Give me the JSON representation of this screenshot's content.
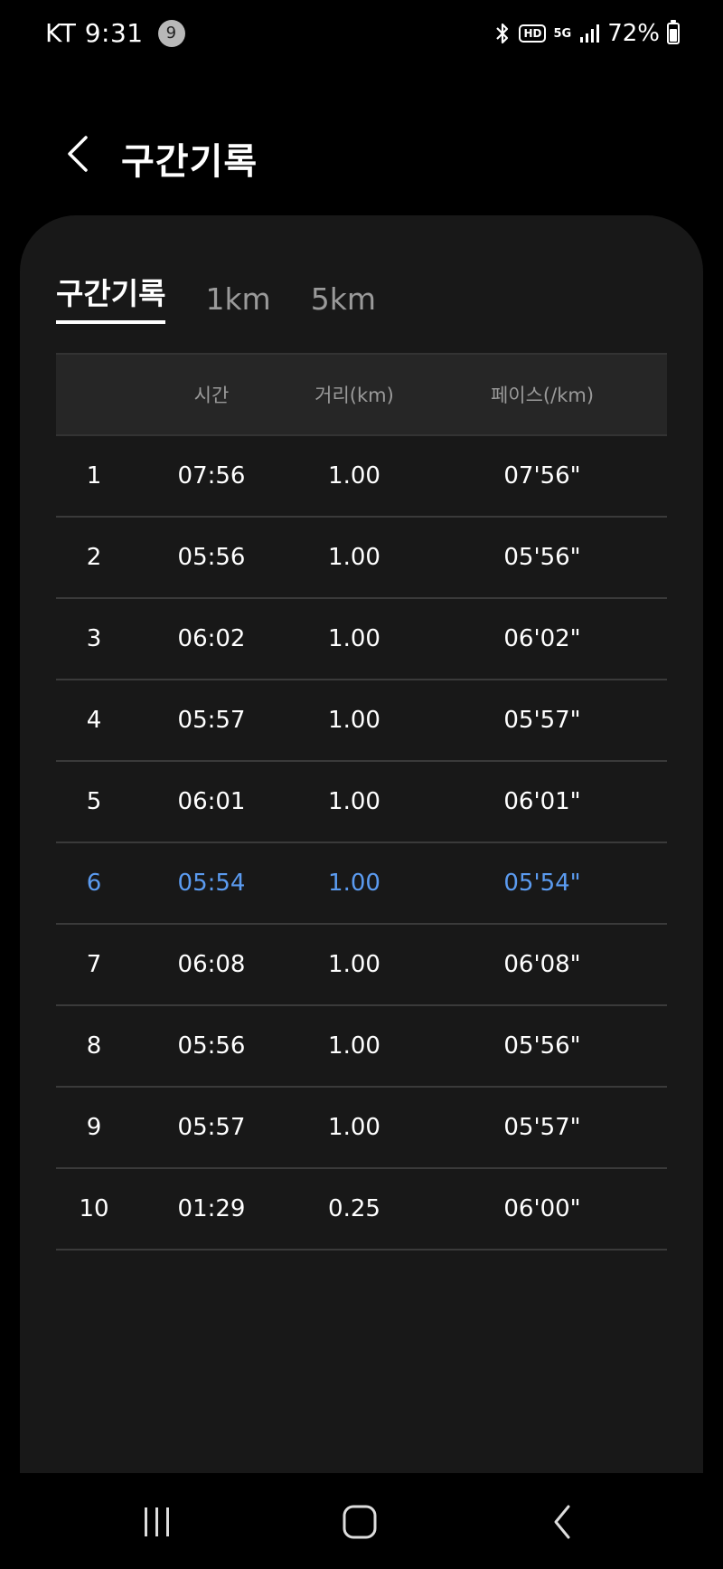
{
  "status_bar": {
    "carrier_time": "KT 9:31",
    "notification_count": "9",
    "hd_label": "HD",
    "network_label": "5G",
    "battery": "72%",
    "battery_level": 0.72
  },
  "header": {
    "title": "구간기록"
  },
  "tabs": [
    {
      "label": "구간기록",
      "active": true
    },
    {
      "label": "1km",
      "active": false
    },
    {
      "label": "5km",
      "active": false
    }
  ],
  "table": {
    "columns": [
      "",
      "시간",
      "거리(km)",
      "페이스(/km)"
    ],
    "rows": [
      {
        "idx": "1",
        "time": "07:56",
        "distance": "1.00",
        "pace": "07'56\""
      },
      {
        "idx": "2",
        "time": "05:56",
        "distance": "1.00",
        "pace": "05'56\""
      },
      {
        "idx": "3",
        "time": "06:02",
        "distance": "1.00",
        "pace": "06'02\""
      },
      {
        "idx": "4",
        "time": "05:57",
        "distance": "1.00",
        "pace": "05'57\""
      },
      {
        "idx": "5",
        "time": "06:01",
        "distance": "1.00",
        "pace": "06'01\""
      },
      {
        "idx": "6",
        "time": "05:54",
        "distance": "1.00",
        "pace": "05'54\"",
        "highlight": true
      },
      {
        "idx": "7",
        "time": "06:08",
        "distance": "1.00",
        "pace": "06'08\""
      },
      {
        "idx": "8",
        "time": "05:56",
        "distance": "1.00",
        "pace": "05'56\""
      },
      {
        "idx": "9",
        "time": "05:57",
        "distance": "1.00",
        "pace": "05'57\""
      },
      {
        "idx": "10",
        "time": "01:29",
        "distance": "0.25",
        "pace": "06'00\""
      }
    ]
  },
  "colors": {
    "background": "#000000",
    "card": "#181818",
    "header_row": "#262626",
    "highlight": "#5b9bf0",
    "muted_text": "#9a9a9a"
  },
  "nav_bar": {
    "icons": [
      "recent-apps-icon",
      "home-icon",
      "back-icon"
    ]
  }
}
